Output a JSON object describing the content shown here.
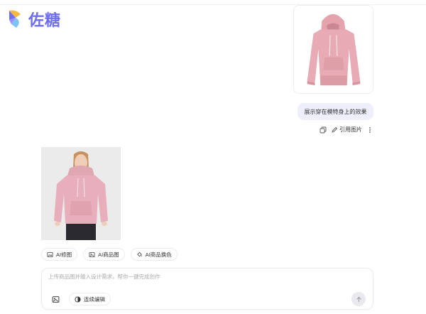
{
  "brand": {
    "name": "佐糖",
    "color": "#6f6ef2"
  },
  "conversation": {
    "user_prompt": "展示穿在模特身上的效果",
    "actions": {
      "quote_label": "引用图片"
    }
  },
  "tools": [
    {
      "label": "AI修图",
      "icon": "image-edit-icon"
    },
    {
      "label": "AI商品图",
      "icon": "product-image-icon"
    },
    {
      "label": "AI商品换色",
      "icon": "paint-bucket-icon"
    }
  ],
  "composer": {
    "placeholder": "上传商品图并输入设计需求，帮你一键完成创作",
    "continuous_edit_label": "连续编辑"
  },
  "colors": {
    "hoodie": "#e8aab4",
    "bubble": "#eeeefc"
  }
}
